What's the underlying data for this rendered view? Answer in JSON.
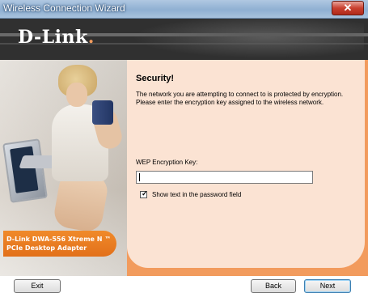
{
  "window": {
    "title": "Wireless Connection Wizard",
    "close_icon": "close-icon"
  },
  "header": {
    "logo_text": "D-Link",
    "logo_mark": "."
  },
  "left_panel": {
    "product_line1": "D-Link DWA-556 Xtreme N ™",
    "product_line2": "PCIe Desktop Adapter"
  },
  "content": {
    "heading": "Security!",
    "description": "The network you are attempting to connect to is protected by encryption. Please enter the encryption key assigned to the wireless network.",
    "wep_label": "WEP Encryption Key:",
    "wep_value": "",
    "show_text_label": "Show text in the password field",
    "show_text_checked": true
  },
  "footer": {
    "exit_label": "Exit",
    "back_label": "Back",
    "next_label": "Next"
  },
  "colors": {
    "accent": "#f29b5d",
    "panel": "#fbe3d3",
    "product_box": "#e2701a",
    "header": "#303030"
  }
}
